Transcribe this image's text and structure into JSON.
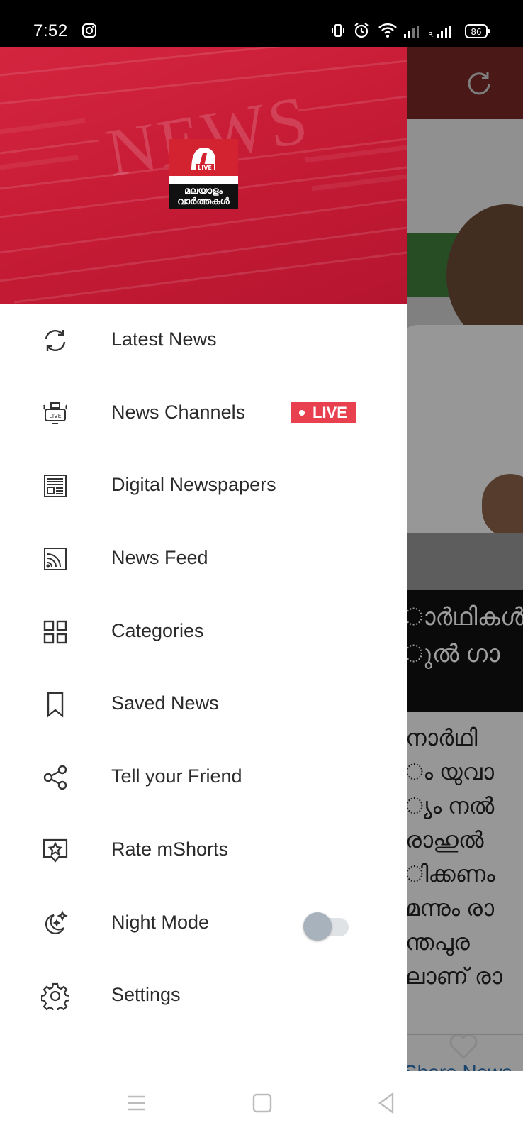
{
  "status_bar": {
    "time": "7:52",
    "battery": "86",
    "icons": [
      "instagram-icon",
      "vibrate-icon",
      "alarm-icon",
      "wifi-icon",
      "signal-icon",
      "roaming-signal-icon",
      "battery-icon"
    ]
  },
  "background_app": {
    "headline_lines": [
      "ാർഥികൾ",
      "ുൽ ഗാ"
    ],
    "body_lines": [
      "നാർഥി",
      "ം യുവാ",
      "്യം നൽ",
      "രാഹുൽ",
      "ിക്കണം",
      "മന്നും രാ",
      "ന്തപുര",
      "ലാണ് രാ"
    ],
    "share_label": "Share News"
  },
  "drawer": {
    "header": {
      "watermark_text": "NEWS",
      "logo_badge": "LIVE",
      "logo_text_line1": "മലയാളം",
      "logo_text_line2": "വാർത്തകൾ"
    },
    "menu": [
      {
        "label": "Latest News",
        "icon": "refresh-icon"
      },
      {
        "label": "News Channels",
        "icon": "live-tv-icon",
        "badge": "LIVE"
      },
      {
        "label": "Digital Newspapers",
        "icon": "newspaper-icon"
      },
      {
        "label": "News Feed",
        "icon": "rss-feed-icon"
      },
      {
        "label": "Categories",
        "icon": "grid-icon"
      },
      {
        "label": "Saved News",
        "icon": "bookmark-icon"
      },
      {
        "label": "Tell your Friend",
        "icon": "share-icon"
      },
      {
        "label": "Rate mShorts",
        "icon": "rate-star-icon"
      },
      {
        "label": "Night Mode",
        "icon": "night-mode-icon",
        "toggle_on": false
      },
      {
        "label": "Settings",
        "icon": "settings-gear-icon"
      }
    ]
  },
  "colors": {
    "header_red": "#c81c36",
    "live_badge": "#e8404f",
    "toggle_thumb": "#a8b2bc",
    "menu_text": "#2b2b2b"
  },
  "nav_bar": {
    "buttons": [
      "menu-nav-icon",
      "home-nav-icon",
      "back-nav-icon"
    ]
  }
}
